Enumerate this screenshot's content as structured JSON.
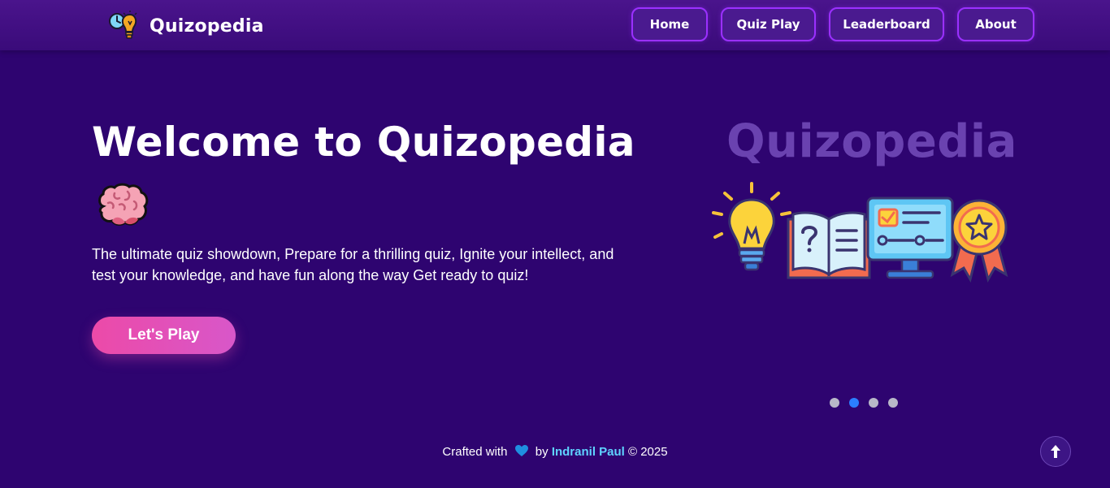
{
  "nav": {
    "brand": "Quizopedia",
    "links": [
      {
        "label": "Home"
      },
      {
        "label": "Quiz Play"
      },
      {
        "label": "Leaderboard"
      },
      {
        "label": "About"
      }
    ]
  },
  "hero": {
    "title": "Welcome to Quizopedia",
    "description": "The ultimate quiz showdown, Prepare for a thrilling quiz, Ignite your intellect, and test your knowledge, and have fun along the way Get ready to quiz!",
    "cta_label": "Let's Play"
  },
  "illustration": {
    "word": "Quizopedia"
  },
  "carousel": {
    "slide_count": 4,
    "active_index": 1
  },
  "footer": {
    "prefix": "Crafted with",
    "by": "by",
    "author": "Indranil Paul",
    "copyright": "© 2025"
  },
  "colors": {
    "background": "#2e0470",
    "accent": "#9b30ff",
    "cta": "#ec4aa8",
    "author": "#5fd3ff",
    "active_dot": "#2b7fff"
  },
  "icons": {
    "brand": "clock-bulb-icon",
    "hero_emoji": "brain-icon",
    "footer_heart": "heart-icon",
    "scroll_top": "arrow-up-icon"
  }
}
